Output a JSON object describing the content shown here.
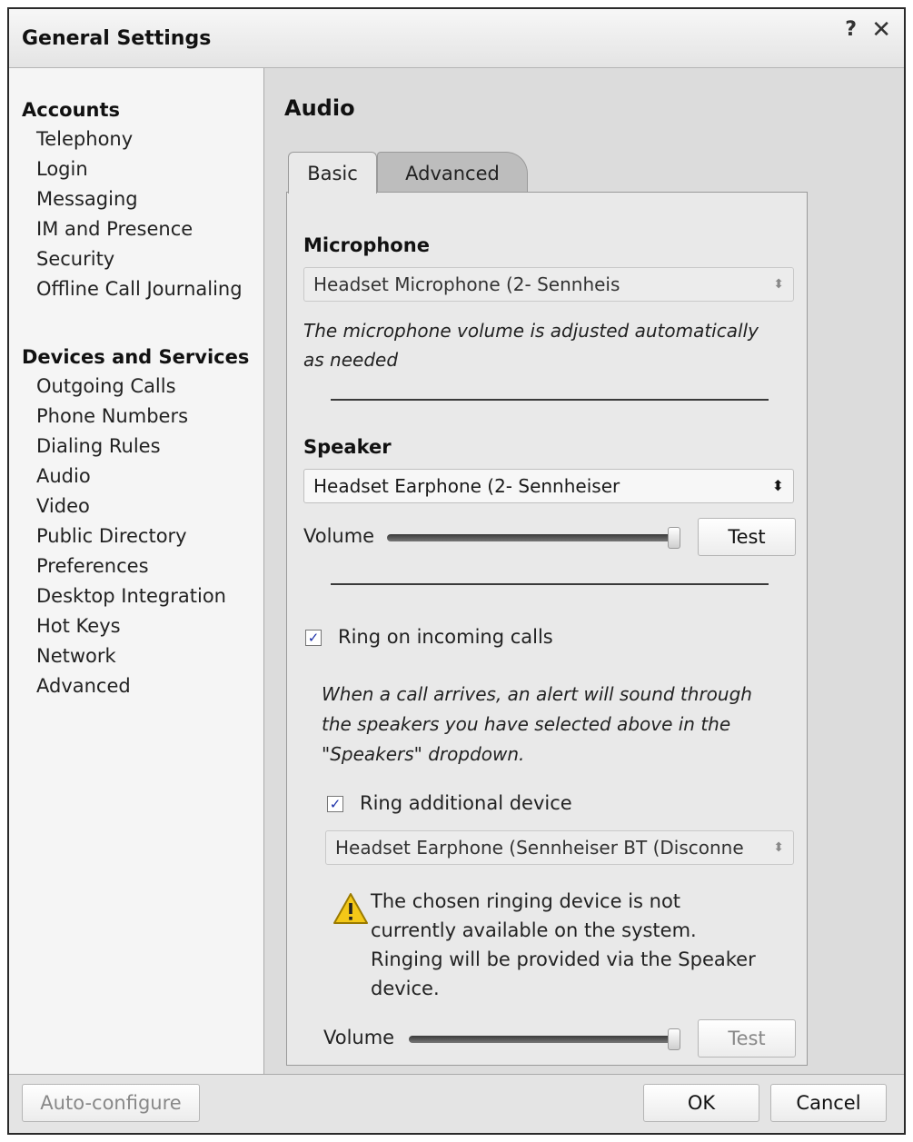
{
  "window": {
    "title": "General Settings",
    "help_label": "?",
    "close_label": "✕"
  },
  "sidebar": {
    "groups": [
      {
        "heading": "Accounts",
        "items": [
          "Telephony",
          "Login",
          "Messaging",
          "IM and Presence",
          "Security",
          "Offline Call Journaling"
        ]
      },
      {
        "heading": "Devices and Services",
        "items": [
          "Outgoing Calls",
          "Phone Numbers",
          "Dialing Rules",
          "Audio",
          "Video",
          "Public Directory",
          "Preferences",
          "Desktop Integration",
          "Hot Keys",
          "Network",
          "Advanced"
        ]
      }
    ]
  },
  "main": {
    "section_title": "Audio",
    "tabs": [
      {
        "label": "Basic",
        "active": true
      },
      {
        "label": "Advanced",
        "active": false
      }
    ],
    "microphone": {
      "label": "Microphone",
      "selected": "Headset Microphone (2- Sennheis",
      "note_line1": "The microphone volume is adjusted automatically",
      "note_line2": "as needed"
    },
    "speaker": {
      "label": "Speaker",
      "selected": "Headset Earphone (2- Sennheiser",
      "volume_label": "Volume",
      "volume_level": 0.98,
      "test_label": "Test"
    },
    "ring": {
      "checkbox_label": "Ring on incoming calls",
      "checked": true,
      "note_line1": "When a call arrives, an alert will sound through",
      "note_line2": "the speakers you have selected above in the",
      "note_line3": "\"Speakers\" dropdown.",
      "additional_label": "Ring additional device",
      "additional_checked": true,
      "additional_selected": "Headset Earphone (Sennheiser BT (Disconne",
      "warning_line1": "The chosen ringing device is not",
      "warning_line2": "currently available on the system.",
      "warning_line3": "Ringing will be provided via the Speaker",
      "warning_line4": "device.",
      "volume_label": "Volume",
      "volume_level": 0.98,
      "test_label": "Test"
    }
  },
  "footer": {
    "auto_configure_label": "Auto-configure",
    "ok_label": "OK",
    "cancel_label": "Cancel"
  },
  "colors": {
    "checkmark": "#1a2fa8",
    "warning_fill": "#f3c818"
  },
  "icons": {
    "checkbox_checked": "check-icon",
    "warning": "warning-icon",
    "dropdown": "updown-arrows-icon"
  }
}
